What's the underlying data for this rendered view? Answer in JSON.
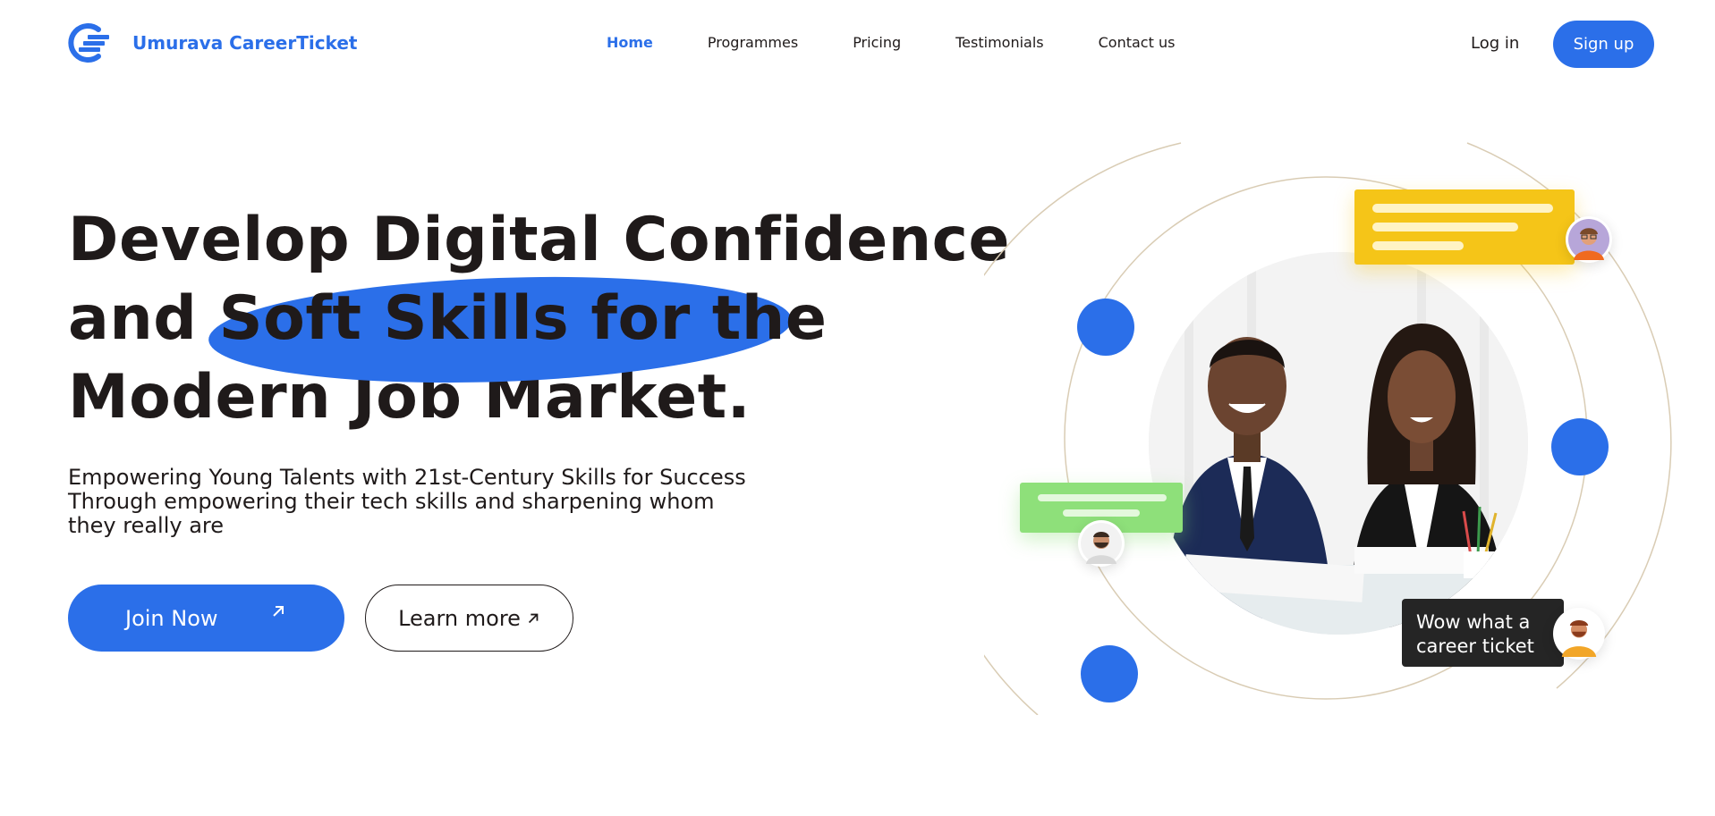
{
  "brand": {
    "name": "Umurava CareerTicket",
    "accent": "#2b6fe9"
  },
  "nav": {
    "items": [
      {
        "label": "Home",
        "active": true
      },
      {
        "label": "Programmes",
        "active": false
      },
      {
        "label": "Pricing",
        "active": false
      },
      {
        "label": "Testimonials",
        "active": false
      },
      {
        "label": "Contact us",
        "active": false
      }
    ],
    "login_label": "Log in",
    "signup_label": "Sign up"
  },
  "hero": {
    "title_line1": "Develop Digital Confidence",
    "title_line2_prefix": "and",
    "title_line2_highlight": "Soft Skills for the",
    "title_line3": "Modern Job Market.",
    "subtitle": "Empowering Young Talents with 21st-Century Skills for Success Through empowering their tech skills and sharpening whom they really are",
    "join_label": "Join Now",
    "join_icon": "arrow-up-right-icon",
    "learn_label": "Learn more",
    "learn_icon": "arrow-up-right-icon"
  },
  "illustration": {
    "chat_text": "Wow what a career ticket",
    "colors": {
      "yellow": "#f5c518",
      "green": "#8ee07a",
      "dark": "#252525",
      "ring": "#d9ccb4"
    }
  }
}
